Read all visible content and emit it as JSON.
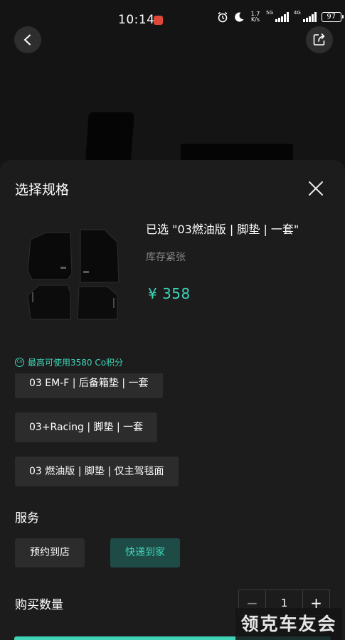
{
  "status_bar": {
    "time": "10:14",
    "net_speed": "1.7\nK/s",
    "sim1_label": "5G",
    "sim2_label": "4G",
    "battery": "97"
  },
  "sheet": {
    "title": "选择规格",
    "selected": "已选 \"03燃油版 | 脚垫 | 一套\"",
    "stock": "库存紧张",
    "price": "¥ 358",
    "points_icon": "Co",
    "points_text": "最高可使用3580 Co积分",
    "specs": [
      "03 EM-F | 后备箱垫 | 一套",
      "03+Racing | 脚垫 | 一套",
      "03 燃油版 | 脚垫 | 仅主驾毯面"
    ],
    "service_heading": "服务",
    "services": [
      "预约到店",
      "快递到家"
    ],
    "quantity_label": "购买数量",
    "quantity_minus": "−",
    "quantity_value": "1",
    "quantity_plus": "+"
  },
  "watermark": "领克车友会",
  "colors": {
    "accent": "#3fd4b8",
    "sheet_bg": "#1c1c1c",
    "chip_bg": "#2c2c2c",
    "selected_chip_bg": "#1f4b47"
  },
  "icons": {
    "back": "chevron-left-icon",
    "share": "share-icon",
    "close": "close-icon",
    "points": "co-coin-icon"
  }
}
